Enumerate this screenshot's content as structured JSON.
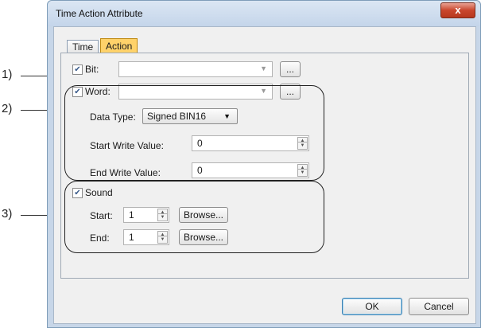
{
  "window": {
    "title": "Time Action Attribute",
    "close_glyph": "x"
  },
  "tabs": [
    {
      "label": "Time"
    },
    {
      "label": "Action"
    }
  ],
  "callouts": [
    "1)",
    "2)",
    "3)"
  ],
  "bit": {
    "label": "Bit:",
    "checked": true,
    "value": "",
    "browse_label": "..."
  },
  "word": {
    "label": "Word:",
    "checked": true,
    "value": "",
    "browse_label": "...",
    "data_type_label": "Data Type:",
    "data_type_value": "Signed BIN16",
    "start_label": "Start Write Value:",
    "start_value": "0",
    "end_label": "End Write Value:",
    "end_value": "0"
  },
  "sound": {
    "label": "Sound",
    "checked": true,
    "start_label": "Start:",
    "start_value": "1",
    "start_browse": "Browse...",
    "end_label": "End:",
    "end_value": "1",
    "end_browse": "Browse..."
  },
  "buttons": {
    "ok": "OK",
    "cancel": "Cancel"
  },
  "icons": {
    "checkbox": "checkmark-icon",
    "dropdown": "chevron-down-icon",
    "spin_up": "spin-up-icon",
    "spin_down": "spin-down-icon"
  }
}
